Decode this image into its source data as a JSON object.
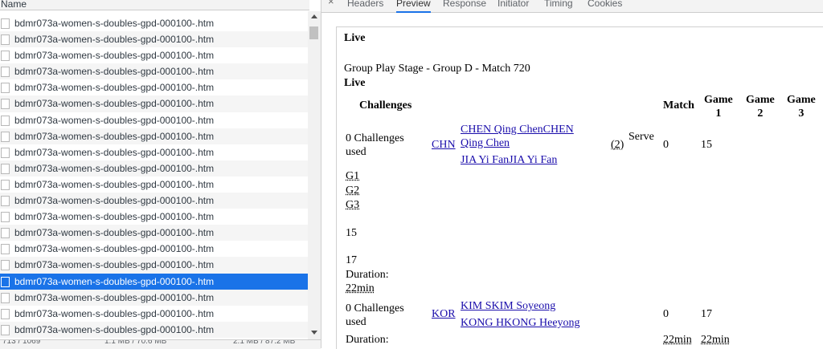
{
  "left": {
    "column_header": "Name",
    "rows": [
      "bdmr073a-women-s-doubles-gpd-000100-.htm",
      "bdmr073a-women-s-doubles-gpd-000100-.htm",
      "bdmr073a-women-s-doubles-gpd-000100-.htm",
      "bdmr073a-women-s-doubles-gpd-000100-.htm",
      "bdmr073a-women-s-doubles-gpd-000100-.htm",
      "bdmr073a-women-s-doubles-gpd-000100-.htm",
      "bdmr073a-women-s-doubles-gpd-000100-.htm",
      "bdmr073a-women-s-doubles-gpd-000100-.htm",
      "bdmr073a-women-s-doubles-gpd-000100-.htm",
      "bdmr073a-women-s-doubles-gpd-000100-.htm",
      "bdmr073a-women-s-doubles-gpd-000100-.htm",
      "bdmr073a-women-s-doubles-gpd-000100-.htm",
      "bdmr073a-women-s-doubles-gpd-000100-.htm",
      "bdmr073a-women-s-doubles-gpd-000100-.htm",
      "bdmr073a-women-s-doubles-gpd-000100-.htm",
      "bdmr073a-women-s-doubles-gpd-000100-.htm",
      "bdmr073a-women-s-doubles-gpd-000100-.htm",
      "bdmr073a-women-s-doubles-gpd-000100-.htm",
      "bdmr073a-women-s-doubles-gpd-000100-.htm",
      "bdmr073a-women-s-doubles-gpd-000100-.htm"
    ],
    "selected_index": 16,
    "status": [
      "713 / 1069",
      "1.1 MB / 70.6 MB",
      "2.1 MB / 87.2 MB"
    ]
  },
  "tabs": [
    "Headers",
    "Preview",
    "Response",
    "Initiator",
    "Timing",
    "Cookies"
  ],
  "active_tab": "Preview",
  "close_icon": "×",
  "preview": {
    "live_top": "Live",
    "stage": "Group Play Stage - Group D  - Match 720",
    "live2": "Live",
    "headers": {
      "challenges": "Challenges",
      "match": "Match",
      "game1": [
        "Game",
        "1"
      ],
      "game2": [
        "Game",
        "2"
      ],
      "game3": [
        "Game",
        "3"
      ]
    },
    "team1": {
      "challenges": [
        "0 Challenges",
        "used"
      ],
      "country": "CHN",
      "player1": [
        "CHEN Qing ChenCHEN",
        "Qing Chen"
      ],
      "player2": "JIA Yi FanJIA Yi Fan",
      "seed": "(2)",
      "serve": "Serve",
      "match": "0",
      "game1": "15"
    },
    "games": [
      "G1",
      "G2",
      "G3"
    ],
    "score_a": "15",
    "score_b": "17",
    "duration_label": "Duration:",
    "duration_value": "22min",
    "team2": {
      "challenges": [
        "0 Challenges",
        "used"
      ],
      "country": "KOR",
      "player1": "KIM SKIM Soyeong",
      "player2": "KONG HKONG Heeyong",
      "match": "0",
      "game1": "17"
    },
    "bottom": {
      "duration_label": "Duration:",
      "match_min": "22min",
      "game1_min": "22min"
    }
  }
}
